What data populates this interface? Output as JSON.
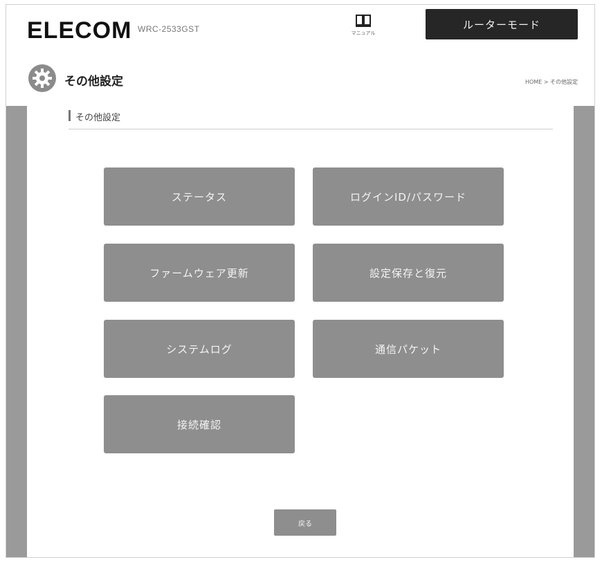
{
  "header": {
    "logo": "ELECOM",
    "model": "WRC-2533GST",
    "manual_label": "マニュアル",
    "mode_label": "ルーターモード"
  },
  "title": {
    "icon": "gear-icon",
    "text": "その他設定",
    "breadcrumb": "HOME > その他設定"
  },
  "section": {
    "title": "その他設定"
  },
  "menu": {
    "items": [
      {
        "label": "ステータス"
      },
      {
        "label": "ログインID/パスワード"
      },
      {
        "label": "ファームウェア更新"
      },
      {
        "label": "設定保存と復元"
      },
      {
        "label": "システムログ"
      },
      {
        "label": "通信パケット"
      },
      {
        "label": "接続確認"
      }
    ]
  },
  "footer": {
    "back_label": "戻る"
  },
  "colors": {
    "button_gray": "#8e8e8e",
    "mode_bar": "#262626",
    "side_bar": "#9a9a9a"
  }
}
